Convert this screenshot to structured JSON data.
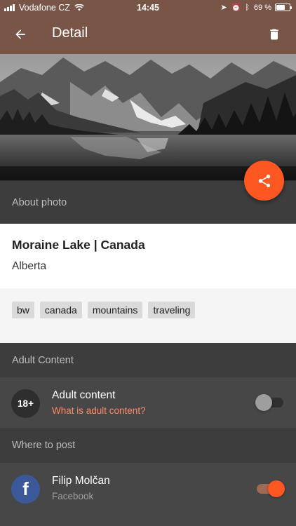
{
  "status_bar": {
    "carrier": "Vodafone CZ",
    "time": "14:45",
    "battery_percent": "69 %",
    "battery_level": 0.69
  },
  "app_bar": {
    "title": "Detail",
    "back_icon": "arrow-back-icon",
    "delete_icon": "trash-icon"
  },
  "hero": {
    "image": "black-and-white photo of a mountain lake with forest",
    "share_icon": "share-icon"
  },
  "about": {
    "header": "About photo",
    "title": "Moraine Lake | Canada",
    "subtitle": "Alberta",
    "tags": [
      "bw",
      "canada",
      "mountains",
      "traveling"
    ]
  },
  "adult": {
    "header": "Adult Content",
    "badge": "18+",
    "title": "Adult content",
    "link": "What is adult content?",
    "enabled": false
  },
  "post": {
    "header": "Where to post",
    "account_name": "Filip Molčan",
    "network": "Facebook",
    "avatar_glyph": "f",
    "enabled": true
  },
  "colors": {
    "primary": "#795548",
    "accent": "#ff5722",
    "link": "#ff8a65",
    "facebook": "#3b5998"
  }
}
